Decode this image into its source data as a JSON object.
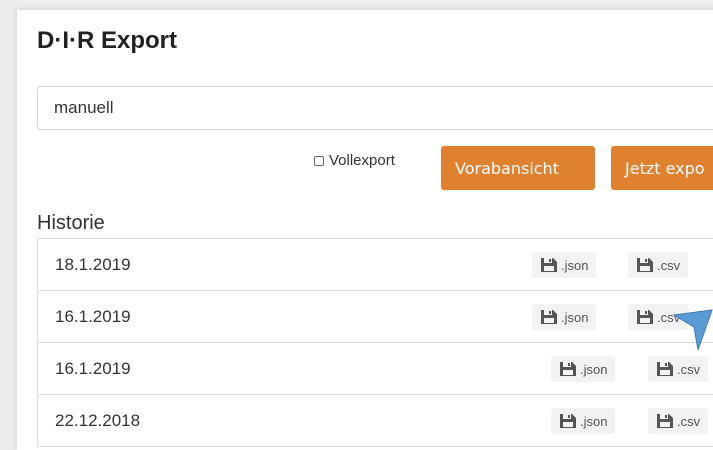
{
  "header": {
    "title": "D·I·R Export"
  },
  "search": {
    "value": "manuell"
  },
  "options": {
    "full_export_label": "Vollexport"
  },
  "actions": {
    "preview_label": "Vorabansicht",
    "export_label": "Jetzt expo"
  },
  "history": {
    "heading": "Historie",
    "rows": [
      {
        "date": "18.1.2019",
        "json_label": ".json",
        "csv_label": ".csv"
      },
      {
        "date": "16.1.2019",
        "json_label": ".json",
        "csv_label": ".csv"
      },
      {
        "date": "16.1.2019",
        "json_label": ".json",
        "csv_label": ".csv"
      },
      {
        "date": "22.12.2018",
        "json_label": ".json",
        "csv_label": ".csv"
      }
    ]
  },
  "colors": {
    "accent": "#e08130",
    "download_bg": "#f2f2f2",
    "pointer": "#5b9bd5"
  },
  "icons": {
    "download": "floppy-disk-icon",
    "pointer": "arrow-pointer-icon"
  }
}
